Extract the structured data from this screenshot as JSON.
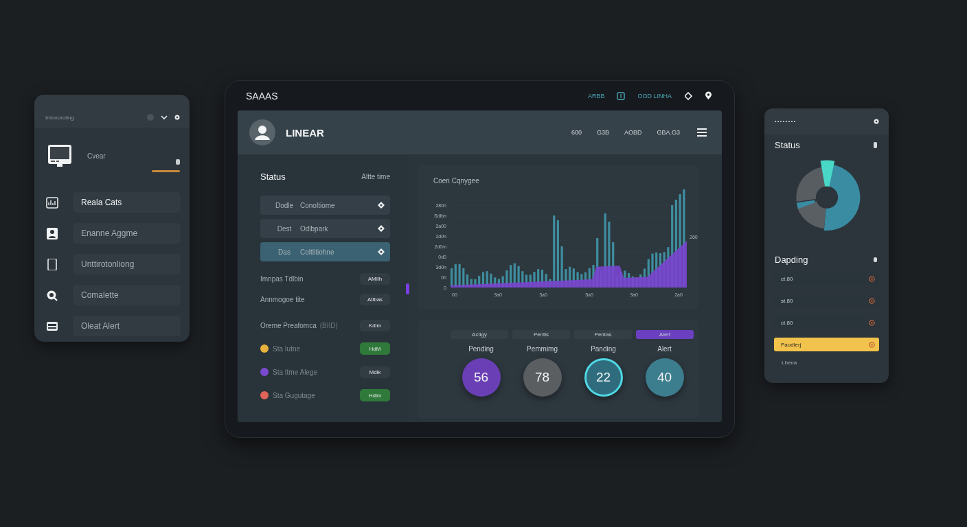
{
  "left_panel": {
    "header": "Imnnoroling",
    "device_label": "Cvear",
    "items": [
      {
        "label": "Reala Cats",
        "selected": true
      },
      {
        "label": "Enanne Aggme",
        "selected": false
      },
      {
        "label": "Unttirotonliong",
        "selected": false
      },
      {
        "label": "Comalette",
        "selected": false
      },
      {
        "label": "Oleat Alert",
        "selected": false
      }
    ]
  },
  "main_window": {
    "title": "SAAAS",
    "top_links": [
      "ARBB",
      "OOD LINHA"
    ],
    "header": {
      "brand": "LINEAR",
      "nav": [
        "600",
        "G3B",
        "AOBD",
        "GBA.G3"
      ]
    },
    "status": {
      "title": "Status",
      "action": "Altte time",
      "options": [
        {
          "code": "Dodle",
          "label": "Conoltiome",
          "selected": false
        },
        {
          "code": "Dest",
          "label": "Odlbpark",
          "selected": false
        },
        {
          "code": "Das",
          "label": "Coltlitiohne",
          "selected": true
        }
      ],
      "metrics": [
        {
          "label": "Imnpas Tdlbin",
          "value": "AMIlh"
        },
        {
          "label": "Annmogoe tite",
          "value": "Atlbas"
        },
        {
          "label": "Oreme Preafomca",
          "note": "(BIID)",
          "value": "Kdlm"
        }
      ],
      "toggles": [
        {
          "label": "Sta Iutne",
          "color": "#e8b03c",
          "value": "HdM",
          "on": true
        },
        {
          "label": "Sta Itme Alege",
          "color": "#7a4bd0",
          "value": "Mdlk",
          "on": false
        },
        {
          "label": "Sta Gugutage",
          "color": "#e06458",
          "value": "Hdlm",
          "on": true
        }
      ]
    },
    "chart": {
      "title": "Coen Cqnygee",
      "y_labels": [
        "280n",
        "Sdlbn",
        "2a00",
        "2d0n",
        "2d0m",
        "0d0",
        "3d0n",
        "0h",
        "0"
      ],
      "x_labels": [
        "00",
        "3a0",
        "3a0",
        "5a0",
        "3a0",
        "2a0"
      ],
      "side_label": "260"
    },
    "summary": {
      "tabs": [
        {
          "label": "Actigy",
          "selected": false
        },
        {
          "label": "Pentis",
          "selected": false
        },
        {
          "label": "Pentas",
          "selected": false
        },
        {
          "label": "Alert",
          "selected": true
        }
      ],
      "stats": [
        {
          "label": "Pending",
          "value": "56",
          "color": "#6a3fb5",
          "ring": false
        },
        {
          "label": "Pemmimg",
          "value": "78",
          "color": "#5b5e61",
          "ring": false
        },
        {
          "label": "Panding",
          "value": "22",
          "color": "#2f6d7e",
          "ring": true
        },
        {
          "label": "Alert",
          "value": "40",
          "color": "#3c7d8e",
          "ring": false
        }
      ]
    }
  },
  "right_panel": {
    "title": "Status",
    "list_title": "Dapding",
    "items": [
      {
        "label": "ct.80",
        "selected": false
      },
      {
        "label": "st.80",
        "selected": false
      },
      {
        "label": "ct.80",
        "selected": false
      },
      {
        "label": "Paodlerj",
        "selected": true
      }
    ],
    "footer": "Lhena"
  }
}
